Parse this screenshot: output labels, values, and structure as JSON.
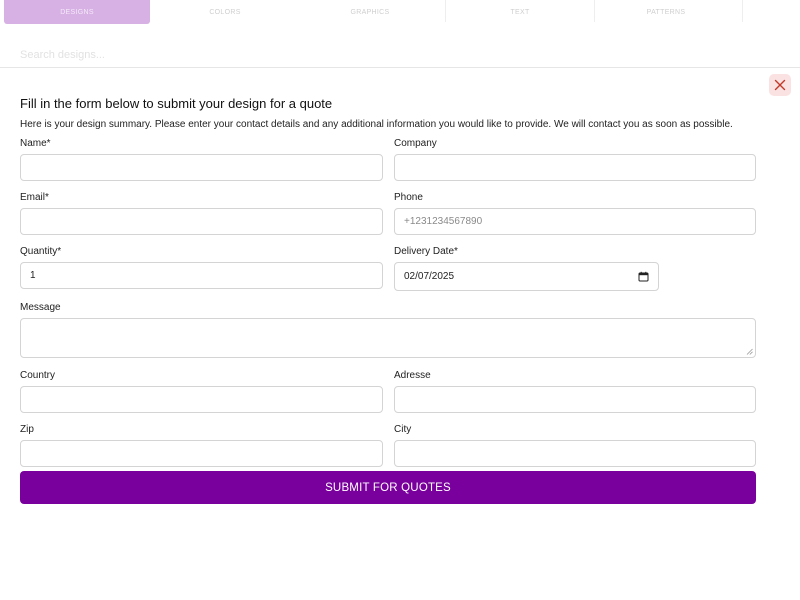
{
  "background": {
    "tabs": [
      "DESIGNS",
      "COLORS",
      "GRAPHICS",
      "TEXT",
      "PATTERNS"
    ],
    "search_placeholder": "Search designs..."
  },
  "modal": {
    "title": "Fill in the form below to submit your design for a quote",
    "description": "Here is your design summary. Please enter your contact details and any additional information you would like to provide. We will contact you as soon as possible.",
    "close_icon": "close-icon",
    "fields": {
      "name": {
        "label": "Name*",
        "value": ""
      },
      "company": {
        "label": "Company",
        "value": ""
      },
      "email": {
        "label": "Email*",
        "value": ""
      },
      "phone": {
        "label": "Phone",
        "value": "",
        "placeholder": "+1231234567890"
      },
      "quantity": {
        "label": "Quantity*",
        "value": "1"
      },
      "delivery_date": {
        "label": "Delivery Date*",
        "value": "02/07/2025"
      },
      "message": {
        "label": "Message",
        "value": ""
      },
      "country": {
        "label": "Country",
        "value": ""
      },
      "address": {
        "label": "Adresse",
        "value": ""
      },
      "zip": {
        "label": "Zip",
        "value": ""
      },
      "city": {
        "label": "City",
        "value": ""
      }
    },
    "submit_label": "SUBMIT FOR QUOTES",
    "accent_color": "#7a009e"
  }
}
